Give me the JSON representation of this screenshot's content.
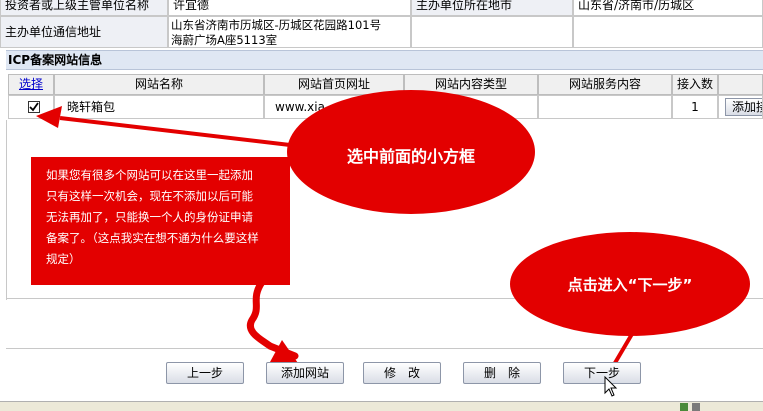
{
  "top_info": {
    "investor_label": "投资者或上级主管单位名称",
    "investor_value": "许宜德",
    "location_label": "主办单位所在地市",
    "location_value": "山东省/济南市/历城区",
    "address_label": "主办单位通信地址",
    "address_line1": "山东省济南市历城区-历城区花园路101号",
    "address_line2": "海蔚广场A座5113室"
  },
  "section_title": "ICP备案网站信息",
  "table": {
    "headers": [
      "选择",
      "网站名称",
      "网站首页网址",
      "网站内容类型",
      "网站服务内容",
      "接入数"
    ],
    "row": {
      "checked": true,
      "name": "晓轩箱包",
      "url": "www.xia",
      "access_count": "1",
      "add_button": "添加接"
    }
  },
  "annotations": {
    "select_tip": "选中前面的小方框",
    "note_lines": [
      "如果您有很多个网站可以在这里一起添加",
      "只有这样一次机会，现在不添加以后可能",
      "无法再加了，只能换一个人的身份证申请",
      "备案了。（这点我实在想不通为什么要这样",
      "规定）"
    ],
    "next_tip": "点击进入“下一步”"
  },
  "buttons": {
    "prev": "上一步",
    "add_site": "添加网站",
    "edit": "修　改",
    "delete": "删　除",
    "next": "下一步"
  },
  "colors": {
    "annotation_red": "#e30000",
    "link_blue": "#0000cc"
  }
}
